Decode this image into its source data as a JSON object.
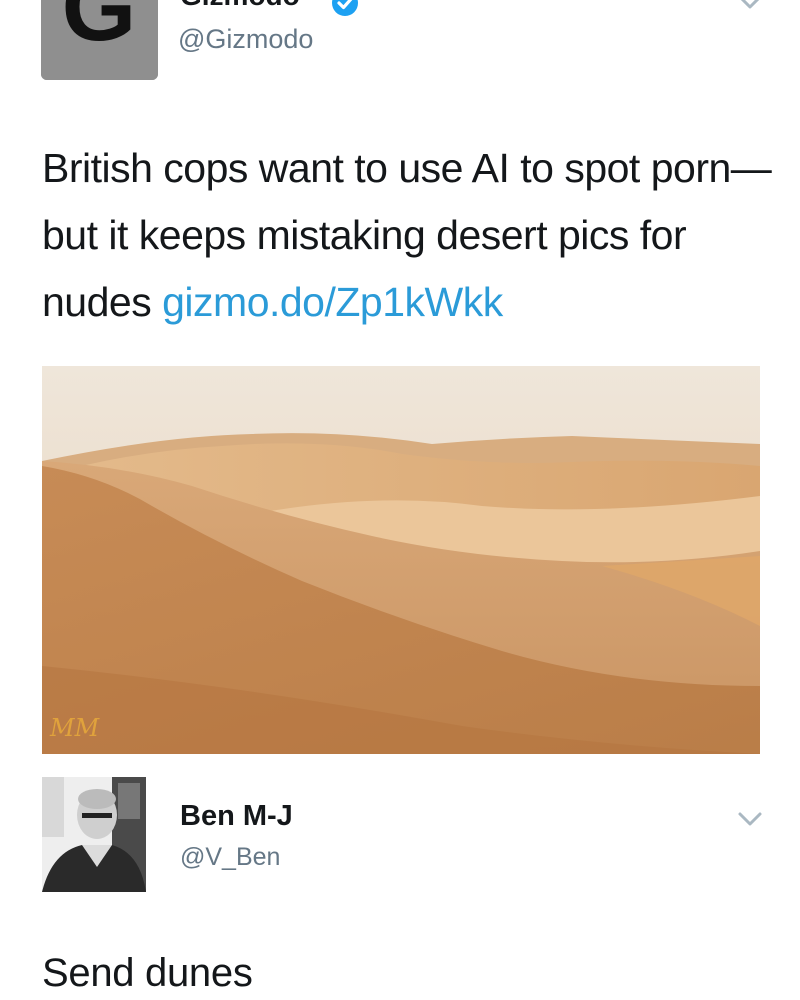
{
  "tweet": {
    "author": {
      "display_name": "Gizmodo",
      "handle": "@Gizmodo",
      "avatar_letter": "G"
    },
    "text_segments": {
      "line": "British cops want to use AI to spot porn—but it keeps mistaking desert pics for nudes",
      "link": "gizmo.do/Zp1kWkk"
    },
    "media": {
      "watermark": "MM",
      "icon": "image-desert-dunes"
    },
    "icons": {
      "verified": "verified-badge-icon",
      "menu": "chevron-down-icon"
    }
  },
  "reply": {
    "author": {
      "display_name": "Ben M-J",
      "handle": "@V_Ben"
    },
    "text": "Send dunes",
    "icons": {
      "menu": "chevron-down-icon"
    }
  },
  "colors": {
    "link": "#2b9bd8",
    "verified": "#1da1f2",
    "handle": "#657786",
    "text": "#14171a"
  }
}
